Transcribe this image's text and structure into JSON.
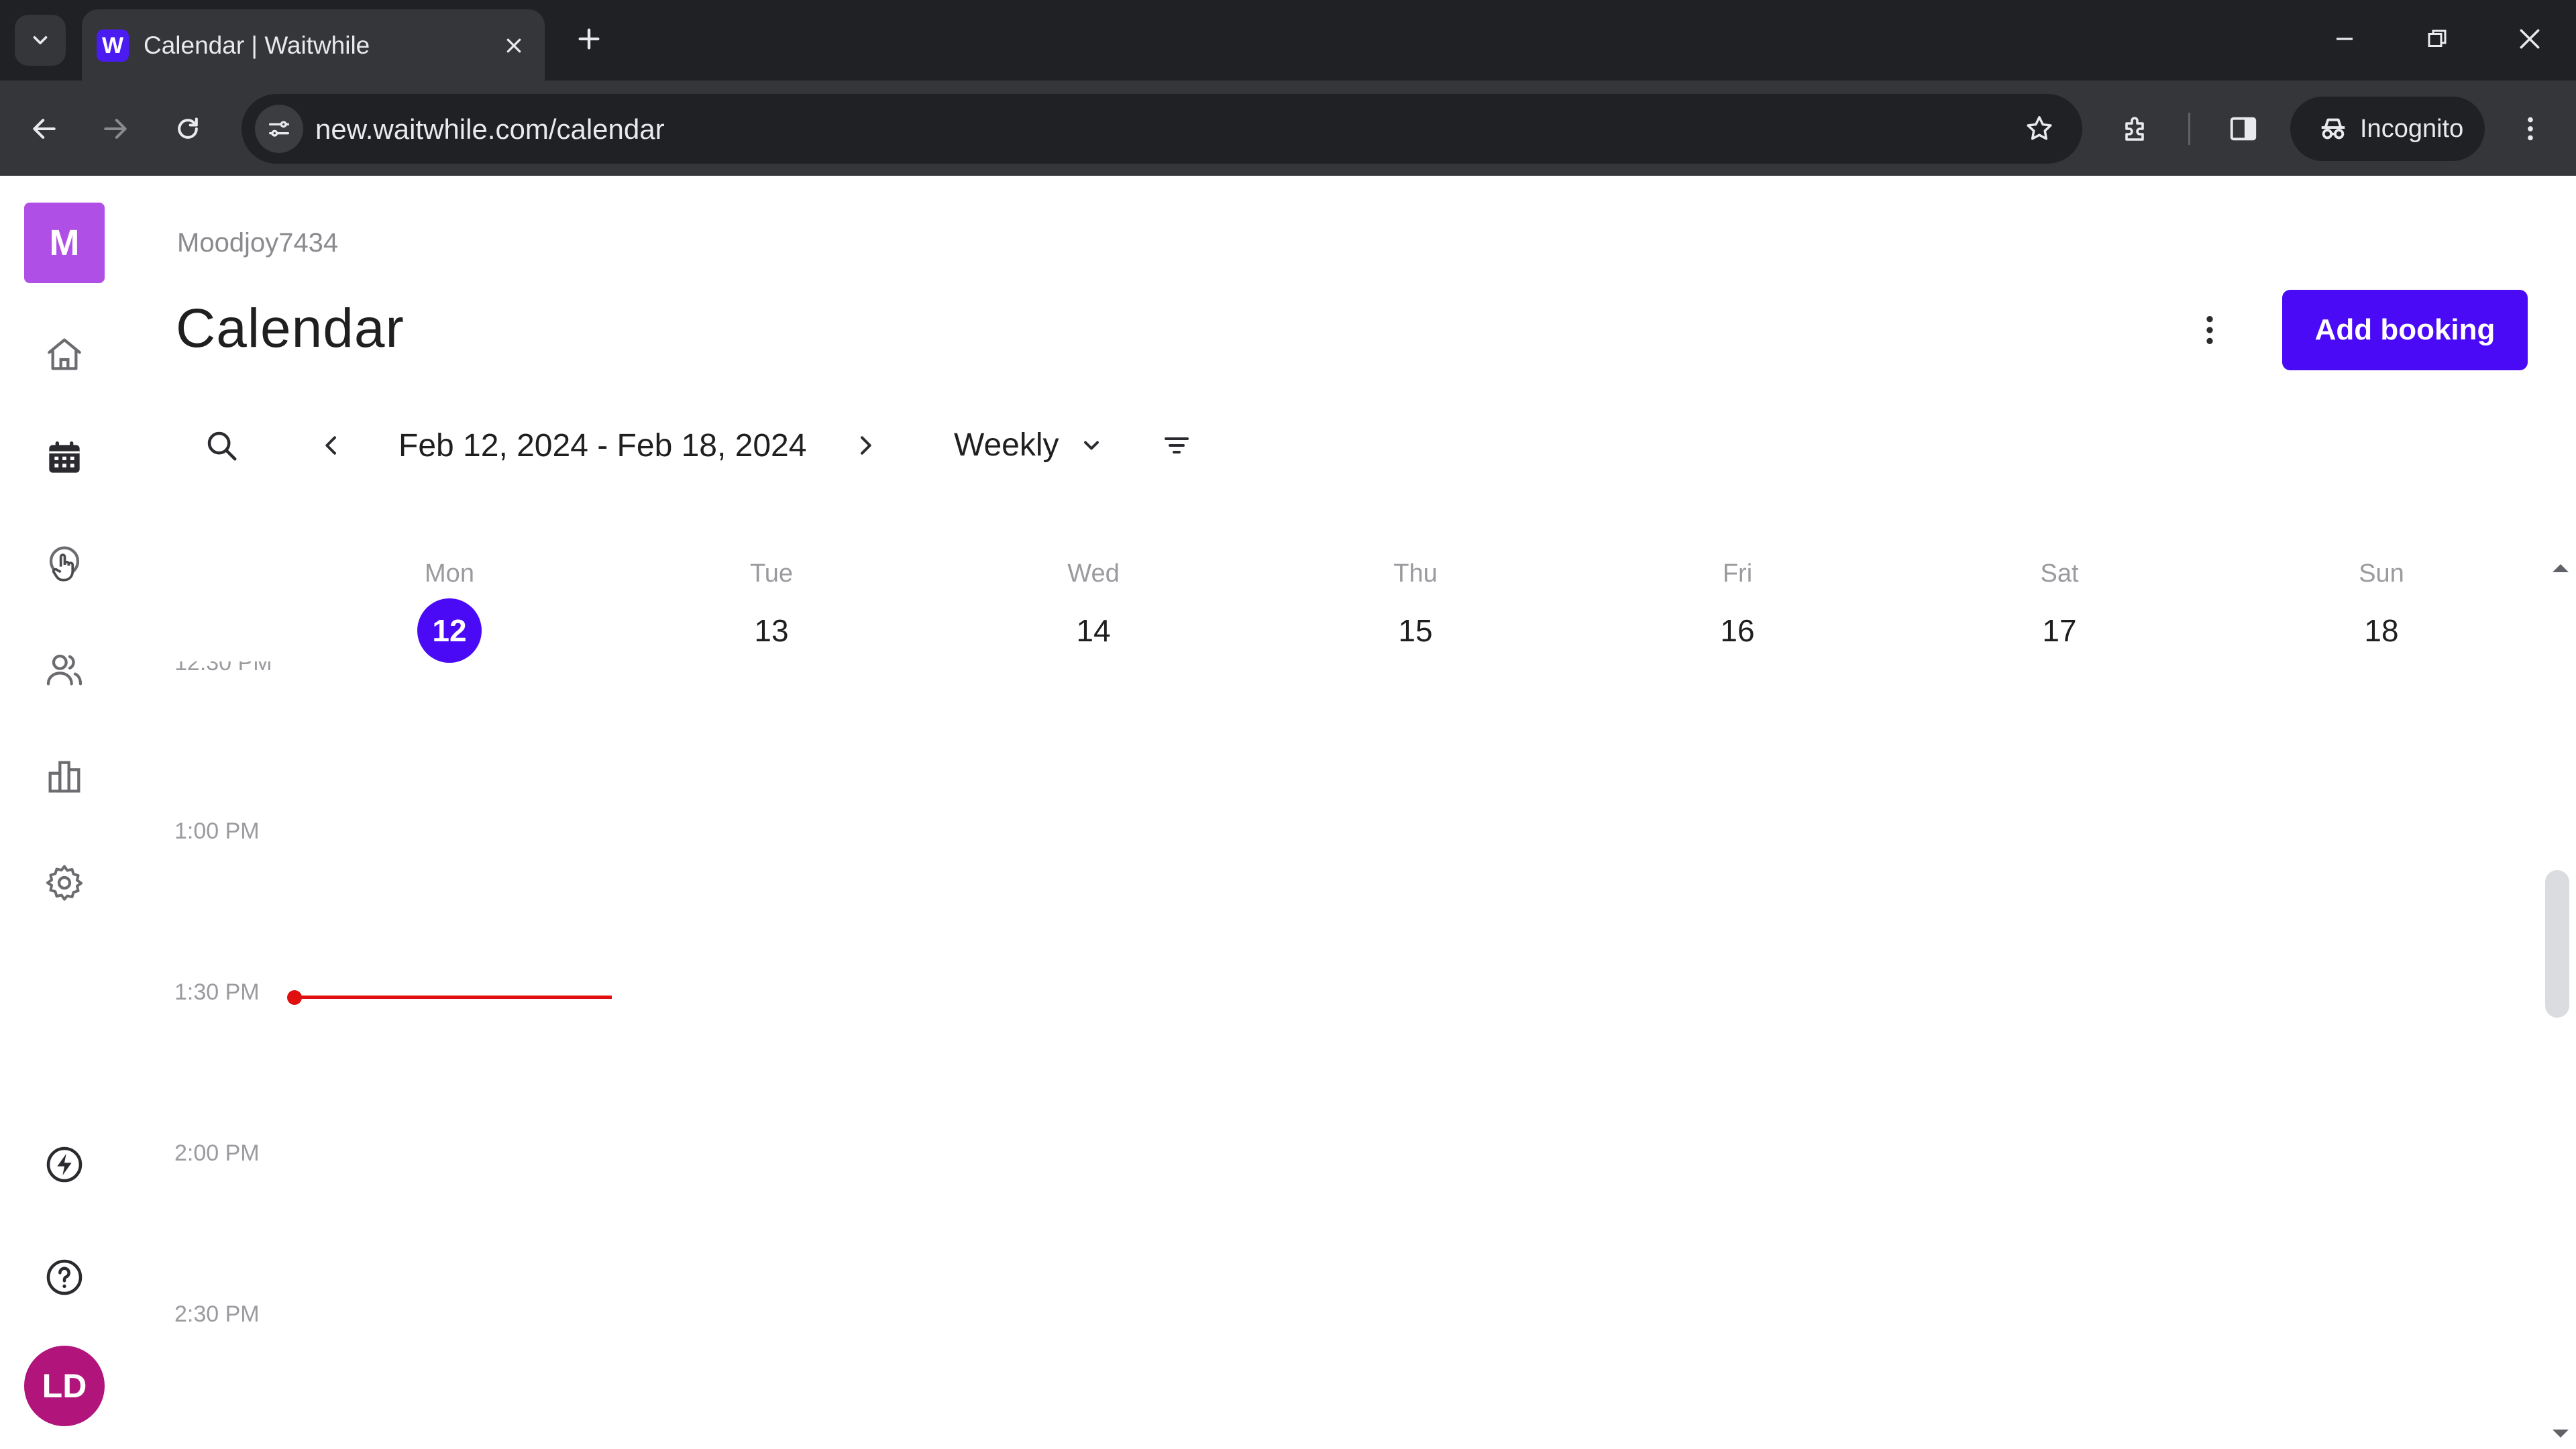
{
  "browser": {
    "tab_title": "Calendar | Waitwhile",
    "favicon_letter": "W",
    "url": "new.waitwhile.com/calendar",
    "incognito_label": "Incognito"
  },
  "sidebar": {
    "workspace_initial": "M",
    "user_initials": "LD",
    "items": [
      {
        "name": "home-icon",
        "active": false
      },
      {
        "name": "calendar-icon",
        "active": true
      },
      {
        "name": "services-icon",
        "active": false
      },
      {
        "name": "customers-icon",
        "active": false
      },
      {
        "name": "analytics-icon",
        "active": false
      },
      {
        "name": "settings-icon",
        "active": false
      },
      {
        "name": "whats-new-icon",
        "active": false
      },
      {
        "name": "help-icon",
        "active": false
      }
    ]
  },
  "header": {
    "workspace_name": "Moodjoy7434",
    "title": "Calendar",
    "add_booking_label": "Add booking"
  },
  "controls": {
    "date_range": "Feb 12, 2024 - Feb 18, 2024",
    "view": "Weekly"
  },
  "week": {
    "days": [
      {
        "name": "Mon",
        "num": "12",
        "today": true
      },
      {
        "name": "Tue",
        "num": "13",
        "today": false
      },
      {
        "name": "Wed",
        "num": "14",
        "today": false
      },
      {
        "name": "Thu",
        "num": "15",
        "today": false
      },
      {
        "name": "Fri",
        "num": "16",
        "today": false
      },
      {
        "name": "Sat",
        "num": "17",
        "today": false
      },
      {
        "name": "Sun",
        "num": "18",
        "today": false
      }
    ],
    "time_labels": [
      "12:30 PM",
      "1:00 PM",
      "1:30 PM",
      "2:00 PM",
      "2:30 PM"
    ]
  },
  "colors": {
    "accent": "#4a0af5",
    "now_indicator": "#e10f0f",
    "workspace_badge": "#b04fe6",
    "avatar": "#b1147a"
  }
}
